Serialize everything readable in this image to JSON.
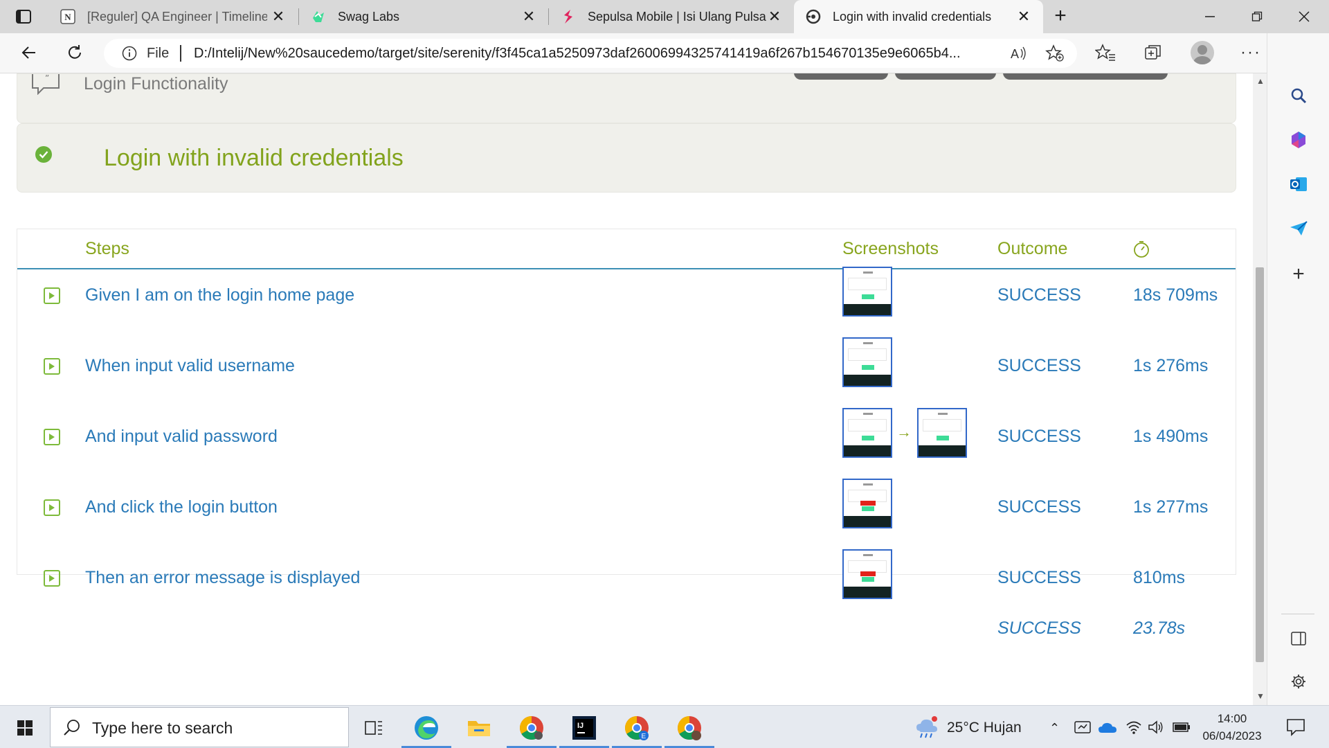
{
  "browser": {
    "tabs": [
      {
        "title": "[Reguler] QA Engineer | Timeline",
        "icon": "notion-icon",
        "active": false
      },
      {
        "title": "Swag Labs",
        "icon": "swag-labs-icon",
        "active": false
      },
      {
        "title": "Sepulsa Mobile | Isi Ulang Pulsa S",
        "icon": "sepulsa-icon",
        "active": false
      },
      {
        "title": "Login with invalid credentials",
        "icon": "serenity-icon",
        "active": true
      }
    ],
    "address": {
      "scheme_label": "File",
      "url": "D:/Intelij/New%20saucedemo/target/site/serenity/f3f45ca1a5250973daf26006994325741419a6f267b154670135e9e6065b4..."
    }
  },
  "report": {
    "feature_title": "Login Functionality",
    "scenario_title": "Login with invalid credentials",
    "headers": {
      "steps": "Steps",
      "screenshots": "Screenshots",
      "outcome": "Outcome"
    },
    "steps": [
      {
        "text": "Given I am on the login home page",
        "outcome": "SUCCESS",
        "duration": "18s 709ms",
        "screenshots": 1,
        "error": false
      },
      {
        "text": "When input valid username",
        "outcome": "SUCCESS",
        "duration": "1s 276ms",
        "screenshots": 1,
        "error": false
      },
      {
        "text": "And input valid password",
        "outcome": "SUCCESS",
        "duration": "1s 490ms",
        "screenshots": 2,
        "error": false
      },
      {
        "text": "And click the login button",
        "outcome": "SUCCESS",
        "duration": "1s 277ms",
        "screenshots": 1,
        "error": true
      },
      {
        "text": "Then an error message is displayed",
        "outcome": "SUCCESS",
        "duration": "810ms",
        "screenshots": 1,
        "error": true
      }
    ],
    "total": {
      "outcome": "SUCCESS",
      "duration": "23.78s"
    }
  },
  "taskbar": {
    "search_placeholder": "Type here to search",
    "weather": "25°C  Hujan",
    "time": "14:00",
    "date": "06/04/2023"
  },
  "colors": {
    "accent_green": "#88a51e",
    "link_blue": "#2a7ab8",
    "success_green": "#6ab23a",
    "header_rule": "#3c8fb5"
  }
}
